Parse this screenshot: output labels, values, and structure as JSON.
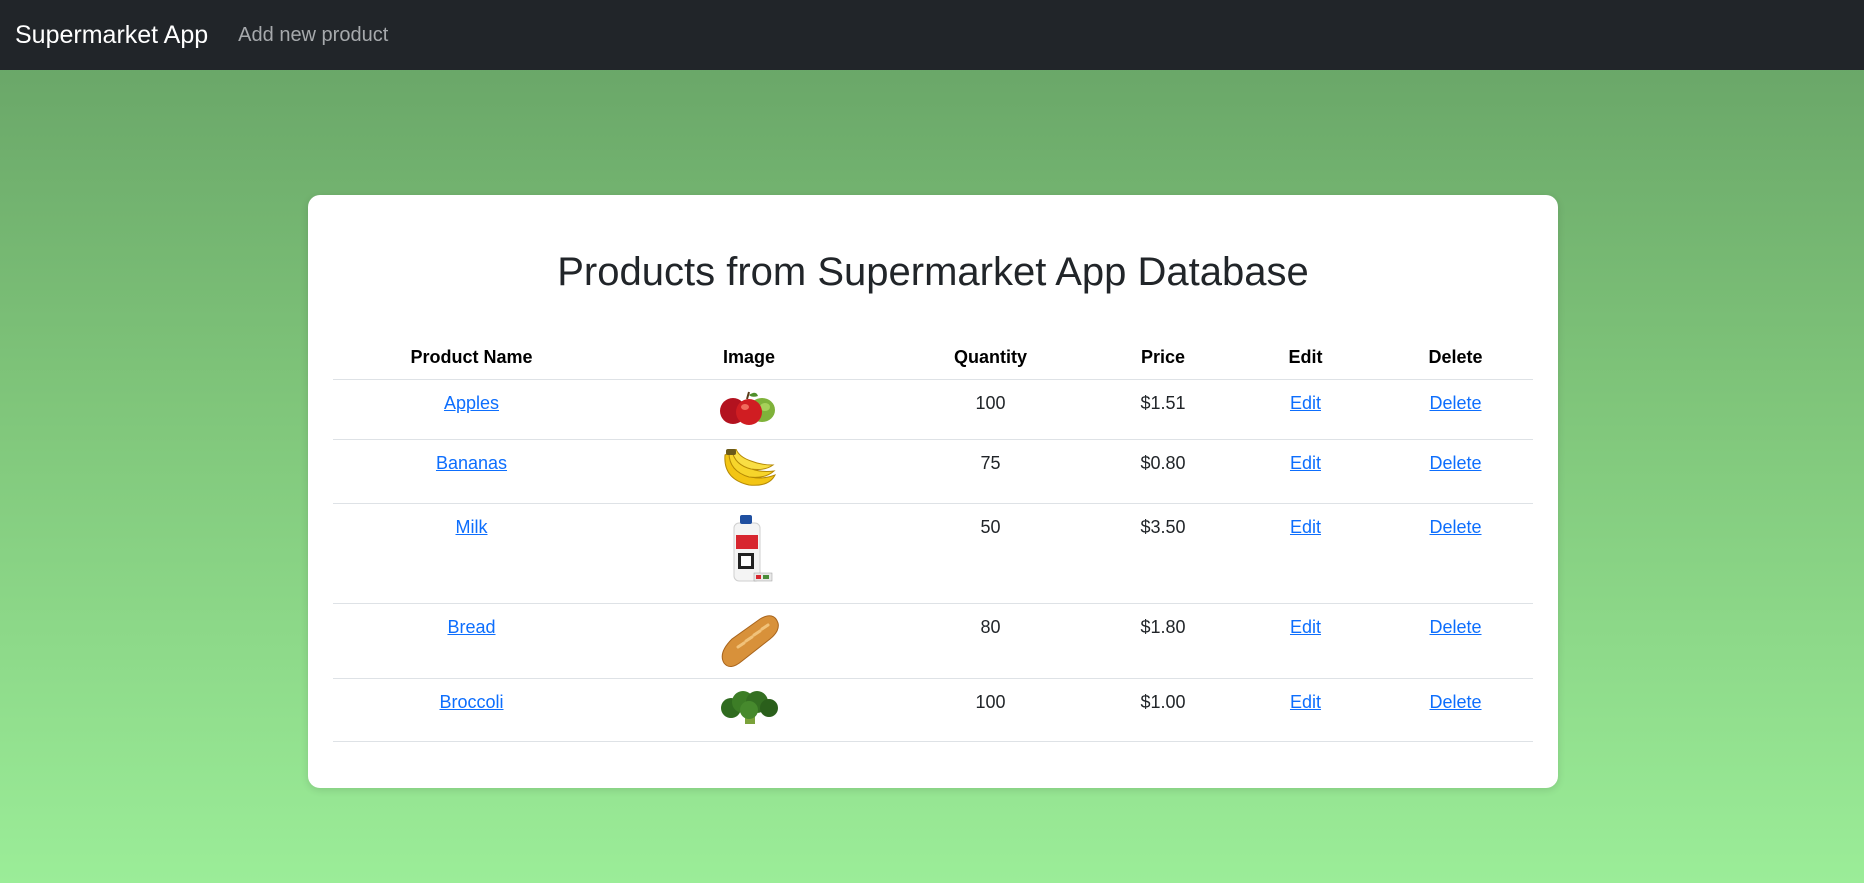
{
  "navbar": {
    "brand": "Supermarket App",
    "add_link": "Add new product"
  },
  "page": {
    "title": "Products from Supermarket App Database"
  },
  "table": {
    "headers": [
      "Product Name",
      "Image",
      "Quantity",
      "Price",
      "Edit",
      "Delete"
    ],
    "rows": [
      {
        "name": "Apples",
        "image_icon": "apples-image",
        "quantity": "100",
        "price": "$1.51",
        "edit": "Edit",
        "delete": "Delete"
      },
      {
        "name": "Bananas",
        "image_icon": "bananas-image",
        "quantity": "75",
        "price": "$0.80",
        "edit": "Edit",
        "delete": "Delete"
      },
      {
        "name": "Milk",
        "image_icon": "milk-image",
        "quantity": "50",
        "price": "$3.50",
        "edit": "Edit",
        "delete": "Delete"
      },
      {
        "name": "Bread",
        "image_icon": "bread-image",
        "quantity": "80",
        "price": "$1.80",
        "edit": "Edit",
        "delete": "Delete"
      },
      {
        "name": "Broccoli",
        "image_icon": "broccoli-image",
        "quantity": "100",
        "price": "$1.00",
        "edit": "Edit",
        "delete": "Delete"
      }
    ]
  },
  "colors": {
    "navbar_bg": "#212529",
    "link": "#0d6efd",
    "background_top": "#66a165",
    "background_bottom": "#9bed98"
  }
}
